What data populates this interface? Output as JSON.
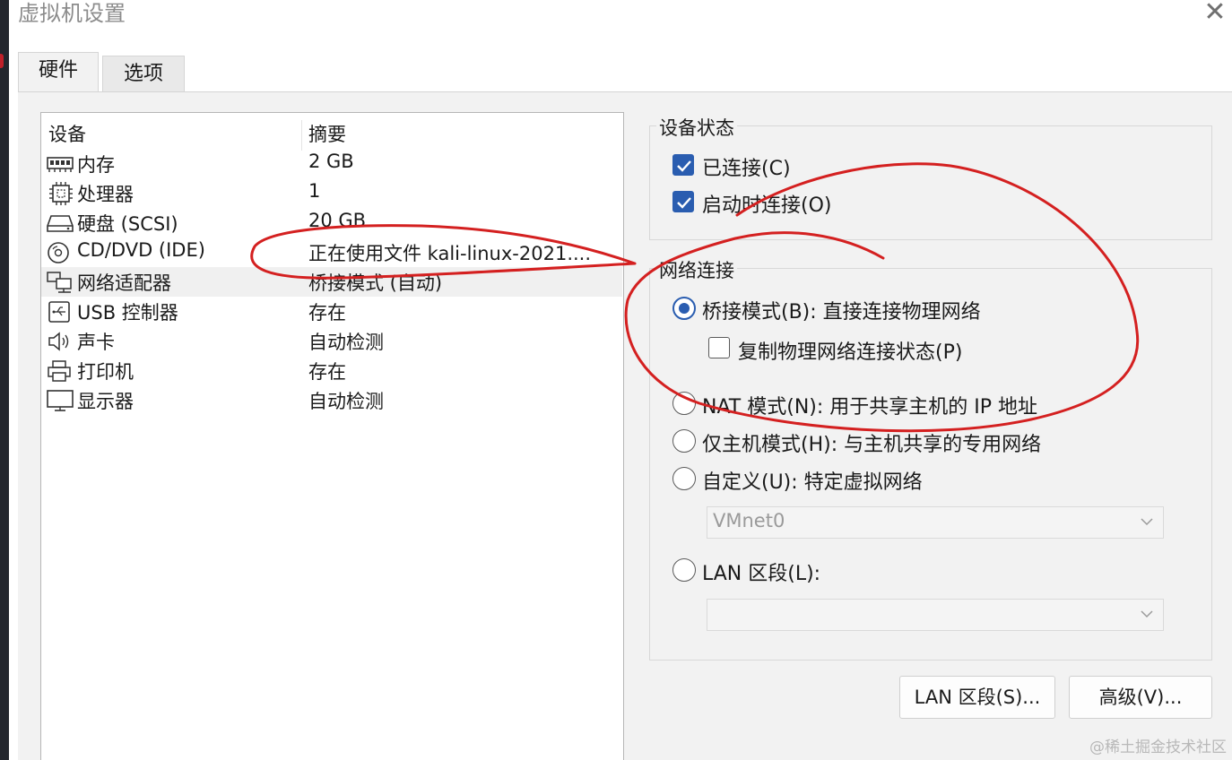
{
  "window": {
    "title": "虚拟机设置",
    "close_glyph": "✕"
  },
  "tabs": [
    {
      "label": "硬件",
      "active": true
    },
    {
      "label": "选项",
      "active": false
    }
  ],
  "device_table": {
    "headers": {
      "device": "设备",
      "summary": "摘要"
    },
    "rows": [
      {
        "name": "内存",
        "summary": "2 GB",
        "icon": "memory-icon"
      },
      {
        "name": "处理器",
        "summary": "1",
        "icon": "processor-icon"
      },
      {
        "name": "硬盘 (SCSI)",
        "summary": "20 GB",
        "icon": "hard-disk-icon"
      },
      {
        "name": "CD/DVD (IDE)",
        "summary": "正在使用文件 kali-linux-2021....",
        "icon": "cd-dvd-icon"
      },
      {
        "name": "网络适配器",
        "summary": "桥接模式 (自动)",
        "icon": "network-adapter-icon",
        "selected": true
      },
      {
        "name": "USB 控制器",
        "summary": "存在",
        "icon": "usb-icon"
      },
      {
        "name": "声卡",
        "summary": "自动检测",
        "icon": "speaker-icon"
      },
      {
        "name": "打印机",
        "summary": "存在",
        "icon": "printer-icon"
      },
      {
        "name": "显示器",
        "summary": "自动检测",
        "icon": "monitor-icon"
      }
    ]
  },
  "device_status": {
    "title": "设备状态",
    "connected": {
      "label": "已连接(C)",
      "checked": true
    },
    "connect_at_power_on": {
      "label": "启动时连接(O)",
      "checked": true
    }
  },
  "network_connection": {
    "title": "网络连接",
    "bridged": {
      "label": "桥接模式(B): 直接连接物理网络",
      "selected": true
    },
    "replicate": {
      "label": "复制物理网络连接状态(P)",
      "checked": false
    },
    "nat": {
      "label": "NAT 模式(N): 用于共享主机的 IP 地址",
      "selected": false
    },
    "host_only": {
      "label": "仅主机模式(H): 与主机共享的专用网络",
      "selected": false
    },
    "custom": {
      "label": "自定义(U): 特定虚拟网络",
      "selected": false
    },
    "custom_select": {
      "value": "VMnet0"
    },
    "lan_segment": {
      "label": "LAN 区段(L):",
      "selected": false
    },
    "lan_select": {
      "value": ""
    }
  },
  "buttons": {
    "lan_segments": "LAN 区段(S)...",
    "advanced": "高级(V)..."
  },
  "watermark": "@稀土掘金技术社区",
  "colors": {
    "accent": "#2a5db0",
    "annotation": "#d42020",
    "panel_bg": "#f2f2f2"
  }
}
